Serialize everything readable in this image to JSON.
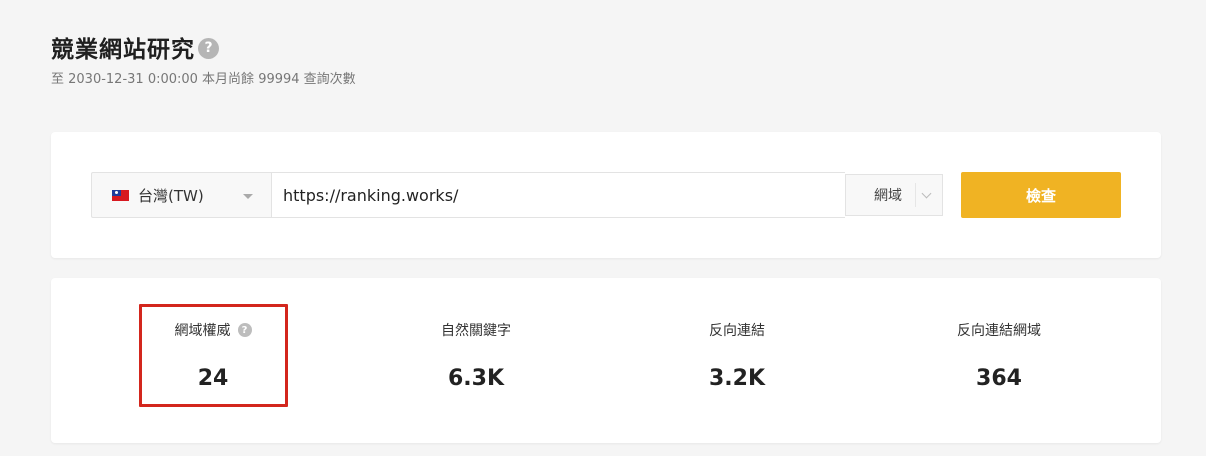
{
  "header": {
    "title": "競業網站研究",
    "help_icon": "question-circle-icon",
    "subtitle": "至 2030-12-31 0:00:00 本月尚餘 99994 查詢次數"
  },
  "search": {
    "country": {
      "flag_icon": "taiwan-flag-icon",
      "label": "台灣(TW)"
    },
    "url_value": "https://ranking.works/",
    "scope": "網域",
    "button_label": "檢查",
    "button_color": "#f0b323"
  },
  "stats": [
    {
      "label": "網域權威",
      "value": "24",
      "has_help": true,
      "highlighted": true
    },
    {
      "label": "自然關鍵字",
      "value": "6.3K",
      "has_help": false,
      "highlighted": false
    },
    {
      "label": "反向連結",
      "value": "3.2K",
      "has_help": false,
      "highlighted": false
    },
    {
      "label": "反向連結網域",
      "value": "364",
      "has_help": false,
      "highlighted": false
    }
  ],
  "colors": {
    "highlight_border": "#d3261d",
    "background": "#f5f5f5"
  }
}
